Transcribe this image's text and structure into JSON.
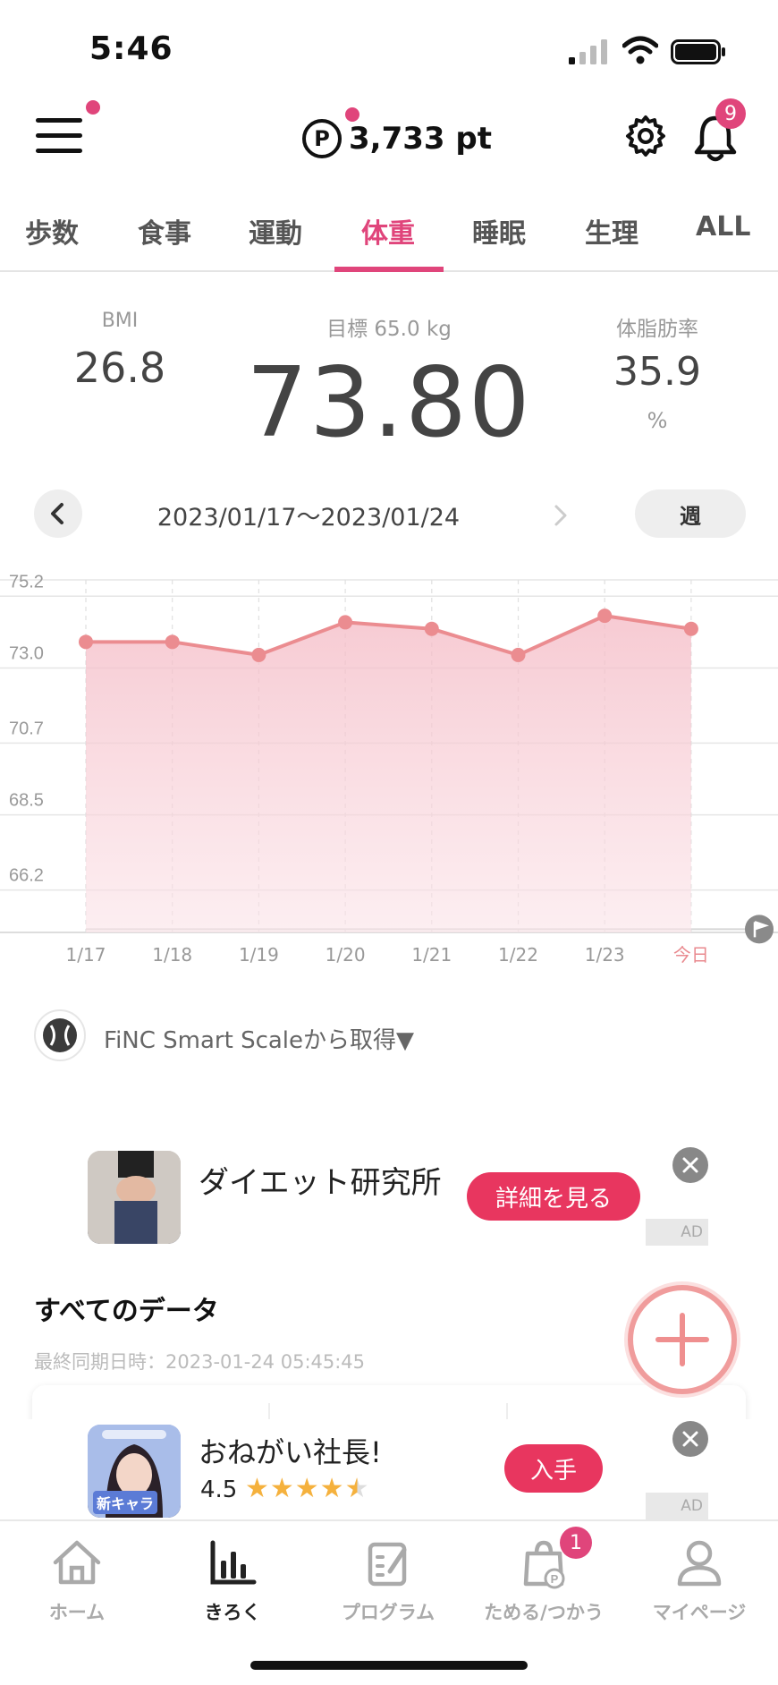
{
  "status_bar": {
    "time": "5:46"
  },
  "header": {
    "points": "3,733 pt",
    "points_symbol": "P",
    "notification_count": "9"
  },
  "tabs": [
    {
      "label": "歩数",
      "active": false
    },
    {
      "label": "食事",
      "active": false
    },
    {
      "label": "運動",
      "active": false
    },
    {
      "label": "体重",
      "active": true
    },
    {
      "label": "睡眠",
      "active": false
    },
    {
      "label": "生理",
      "active": false
    },
    {
      "label": "ALL",
      "active": false
    }
  ],
  "stats": {
    "bmi_label": "BMI",
    "bmi_value": "26.8",
    "goal": "目標 65.0 kg",
    "weight": "73.80",
    "fat_label": "体脂肪率",
    "fat_value": "35.9",
    "fat_unit": "%"
  },
  "date_nav": {
    "range": "2023/01/17〜2023/01/24",
    "period": "週"
  },
  "chart_data": {
    "type": "area",
    "categories": [
      "1/17",
      "1/18",
      "1/19",
      "1/20",
      "1/21",
      "1/22",
      "1/23",
      "今日"
    ],
    "values": [
      73.8,
      73.8,
      73.4,
      74.4,
      74.2,
      73.4,
      74.6,
      74.2
    ],
    "y_ticks": [
      "75.2",
      "73.0",
      "70.7",
      "68.5",
      "66.2"
    ],
    "ylim": [
      64.9,
      75.7
    ],
    "goal_value": 65.0,
    "grid": true,
    "colors": {
      "line": "#eb8c90",
      "fill": "#f7c9d2",
      "today_label": "#e98a8f",
      "goal_flag": "#8a8a8a"
    }
  },
  "source": {
    "label": "FiNC Smart Scaleから取得▼"
  },
  "ad1": {
    "title": "ダイエット研究所",
    "button": "詳細を見る",
    "tag": "AD"
  },
  "all_data": {
    "title": "すべてのデータ",
    "sync": "最終同期日時：2023-01-24 05:45:45"
  },
  "ad2": {
    "title": "おねがい社長!",
    "rating": "4.5",
    "button": "入手",
    "image_label": "新キャラ",
    "tag": "AD"
  },
  "bottom_nav": [
    {
      "label": "ホーム",
      "icon": "home-icon"
    },
    {
      "label": "きろく",
      "icon": "bar-chart-icon"
    },
    {
      "label": "プログラム",
      "icon": "clipboard-icon"
    },
    {
      "label": "ためる/つかう",
      "icon": "shopping-bag-icon"
    },
    {
      "label": "マイページ",
      "icon": "person-icon"
    }
  ],
  "bottom_badge": "1",
  "accent_color": "#e0457b"
}
